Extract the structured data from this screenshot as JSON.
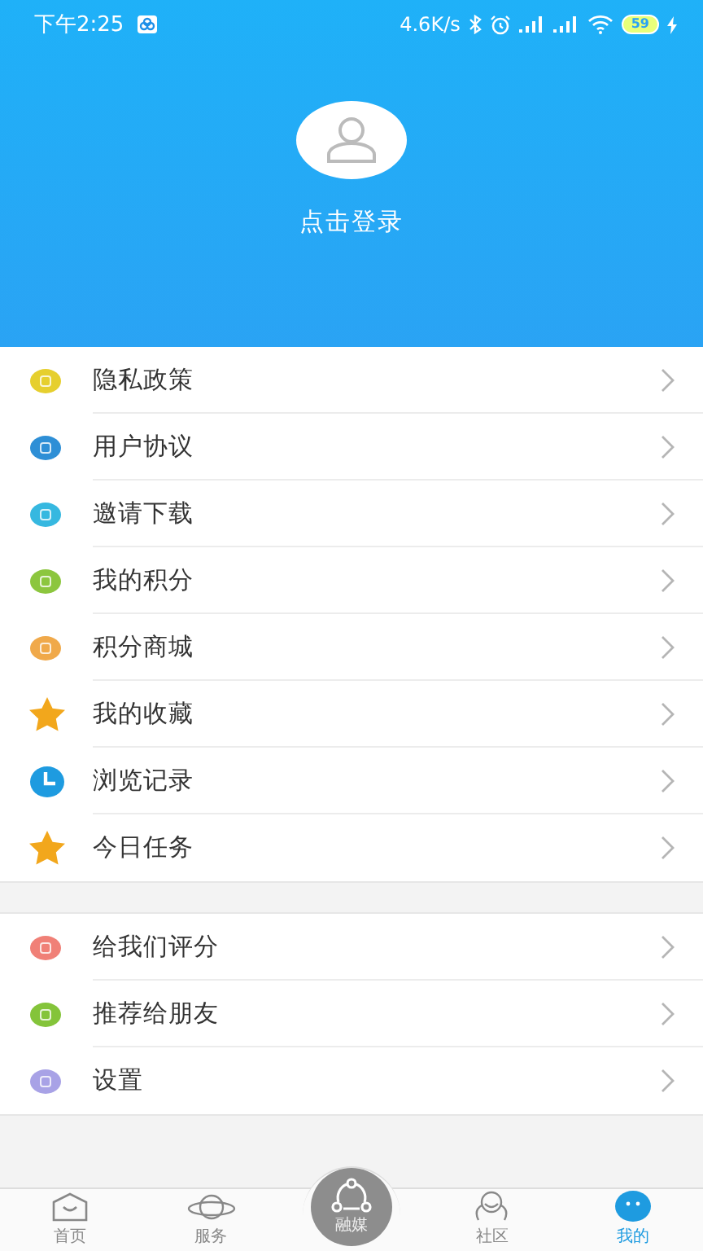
{
  "status_bar": {
    "time": "下午2:25",
    "speed": "4.6K/s",
    "battery": "59"
  },
  "profile": {
    "login_label": "点击登录"
  },
  "menu_groups": [
    {
      "items": [
        {
          "label": "隐私政策",
          "kind": "dot",
          "color": "#e6cf2e"
        },
        {
          "label": "用户协议",
          "kind": "dot",
          "color": "#2e8fd6"
        },
        {
          "label": "邀请下载",
          "kind": "dot",
          "color": "#36b8e0"
        },
        {
          "label": "我的积分",
          "kind": "dot",
          "color": "#8cc63e"
        },
        {
          "label": "积分商城",
          "kind": "dot",
          "color": "#f0a94a"
        },
        {
          "label": "我的收藏",
          "kind": "star",
          "color": "#f2a71c"
        },
        {
          "label": "浏览记录",
          "kind": "clock",
          "color": "#1e9be0"
        },
        {
          "label": "今日任务",
          "kind": "star",
          "color": "#f2a71c"
        }
      ]
    },
    {
      "items": [
        {
          "label": "给我们评分",
          "kind": "dot",
          "color": "#f08077"
        },
        {
          "label": "推荐给朋友",
          "kind": "dot",
          "color": "#84c43a"
        },
        {
          "label": "设置",
          "kind": "dot",
          "color": "#a8a2e6"
        }
      ]
    }
  ],
  "bottom_nav": [
    {
      "label": "首页",
      "kind": "home",
      "selected": false
    },
    {
      "label": "服务",
      "kind": "planet",
      "selected": false
    },
    {
      "label": "融媒",
      "kind": "center",
      "selected": false
    },
    {
      "label": "社区",
      "kind": "community",
      "selected": false
    },
    {
      "label": "我的",
      "kind": "me",
      "selected": true
    }
  ]
}
